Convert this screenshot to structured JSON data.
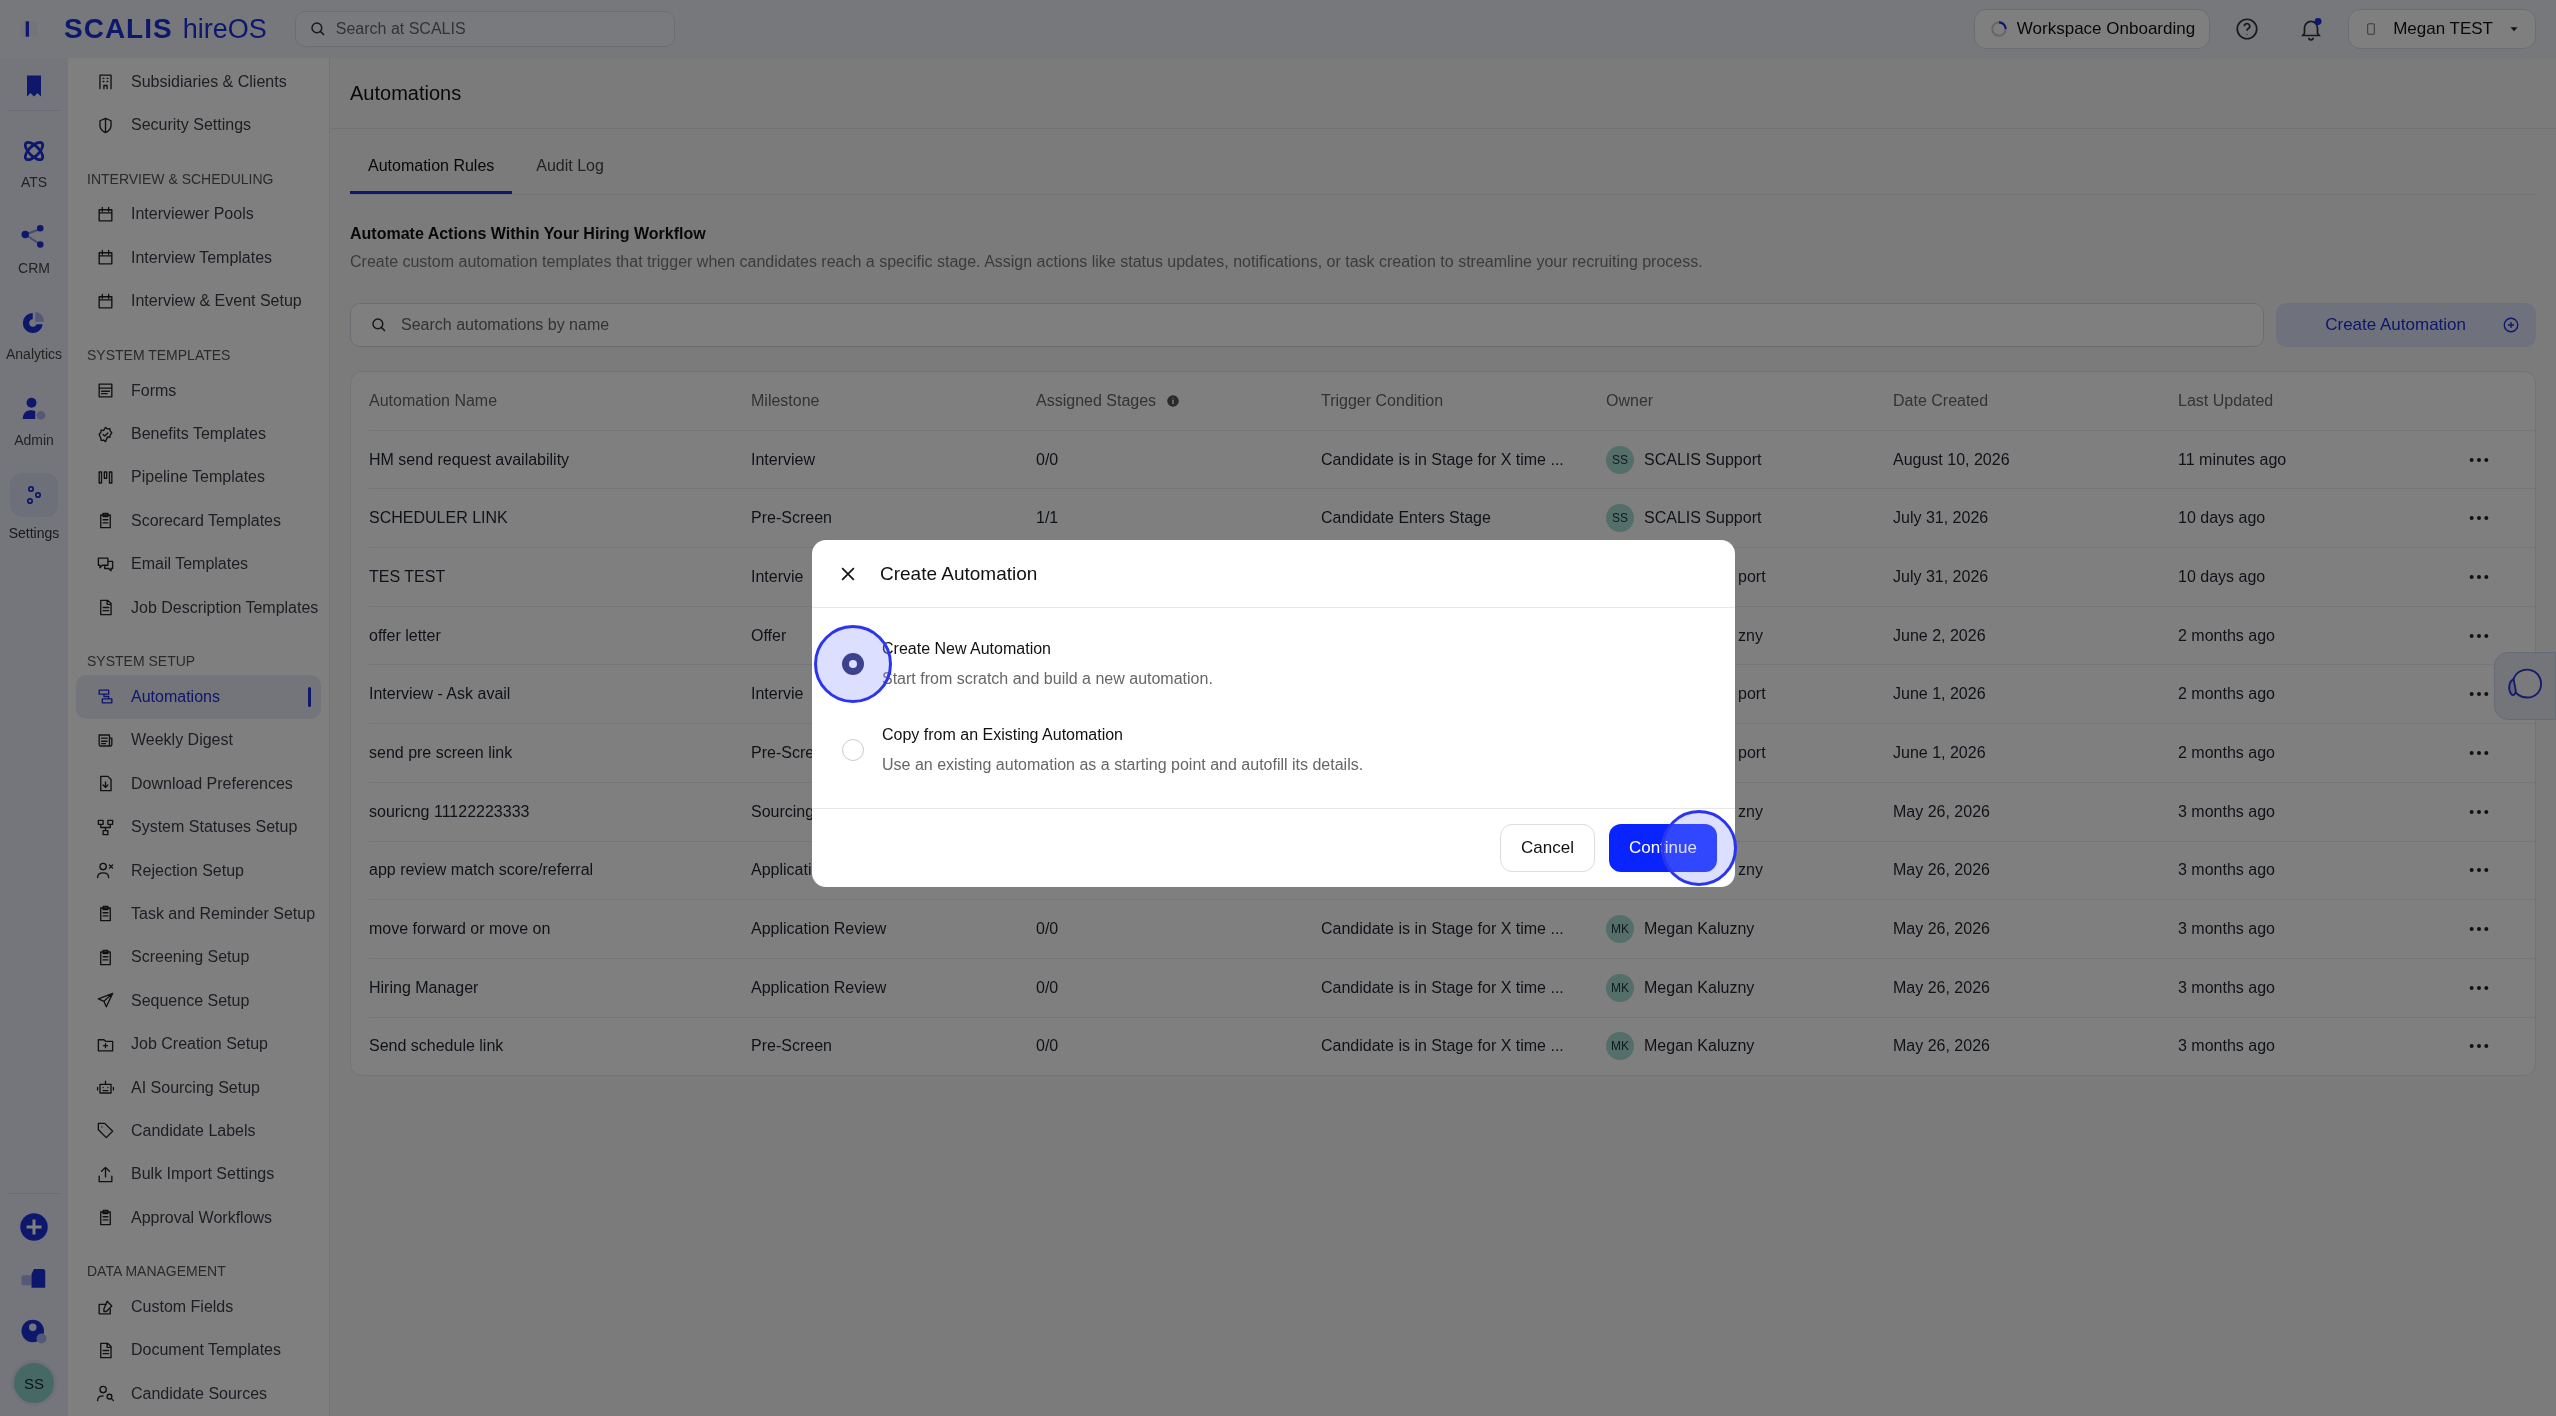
{
  "topbar": {
    "logo": "SCALIS",
    "product": "hireOS",
    "search": {
      "placeholder": "Search at SCALIS"
    },
    "workspace": "Workspace Onboarding",
    "notifications_unread": true,
    "user": "Megan TEST"
  },
  "rail": {
    "items": [
      {
        "label": "ATS",
        "selected": false
      },
      {
        "label": "CRM",
        "selected": false
      },
      {
        "label": "Analytics",
        "selected": false
      },
      {
        "label": "Admin",
        "selected": false
      },
      {
        "label": "Settings",
        "selected": true
      }
    ],
    "avatar": "SS"
  },
  "sidebar": {
    "sections": [
      {
        "items": [
          {
            "label": "Subsidiaries & Clients",
            "selected": false
          },
          {
            "label": "Security Settings",
            "selected": false
          }
        ]
      },
      {
        "title": "INTERVIEW & SCHEDULING",
        "items": [
          {
            "label": "Interviewer Pools",
            "selected": false
          },
          {
            "label": "Interview Templates",
            "selected": false
          },
          {
            "label": "Interview & Event Setup",
            "selected": false
          }
        ]
      },
      {
        "title": "SYSTEM TEMPLATES",
        "items": [
          {
            "label": "Forms",
            "selected": false
          },
          {
            "label": "Benefits Templates",
            "selected": false
          },
          {
            "label": "Pipeline Templates",
            "selected": false
          },
          {
            "label": "Scorecard Templates",
            "selected": false
          },
          {
            "label": "Email Templates",
            "selected": false
          },
          {
            "label": "Job Description Templates",
            "selected": false
          }
        ]
      },
      {
        "title": "SYSTEM SETUP",
        "items": [
          {
            "label": "Automations",
            "selected": true
          },
          {
            "label": "Weekly Digest",
            "selected": false
          },
          {
            "label": "Download Preferences",
            "selected": false
          },
          {
            "label": "System Statuses Setup",
            "selected": false
          },
          {
            "label": "Rejection Setup",
            "selected": false
          },
          {
            "label": "Task and Reminder Setup",
            "selected": false
          },
          {
            "label": "Screening Setup",
            "selected": false
          },
          {
            "label": "Sequence Setup",
            "selected": false
          },
          {
            "label": "Job Creation Setup",
            "selected": false
          },
          {
            "label": "AI Sourcing Setup",
            "selected": false
          },
          {
            "label": "Candidate Labels",
            "selected": false
          },
          {
            "label": "Bulk Import Settings",
            "selected": false
          },
          {
            "label": "Approval Workflows",
            "selected": false
          }
        ]
      },
      {
        "title": "DATA MANAGEMENT",
        "items": [
          {
            "label": "Custom Fields",
            "selected": false
          },
          {
            "label": "Document Templates",
            "selected": false
          },
          {
            "label": "Candidate Sources",
            "selected": false
          }
        ]
      }
    ]
  },
  "page": {
    "title": "Automations",
    "tabs": [
      {
        "label": "Automation Rules",
        "selected": true
      },
      {
        "label": "Audit Log",
        "selected": false
      }
    ],
    "heading": "Automate Actions Within Your Hiring Workflow",
    "description": "Create custom automation templates that trigger when candidates reach a specific stage. Assign actions like status updates, notifications, or task creation to streamline your recruiting process.",
    "search": {
      "placeholder": "Search automations by name"
    },
    "create_button": "Create Automation"
  },
  "table": {
    "columns": [
      {
        "label": "Automation Name",
        "info": false
      },
      {
        "label": "Milestone",
        "info": false
      },
      {
        "label": "Assigned Stages",
        "info": true
      },
      {
        "label": "Trigger Condition",
        "info": false
      },
      {
        "label": "Owner",
        "info": false
      },
      {
        "label": "Date Created",
        "info": false
      },
      {
        "label": "Last Updated",
        "info": false
      }
    ],
    "rows": [
      {
        "name": "HM send request availability",
        "milestone": "Interview",
        "assigned_stages": "0/0",
        "trigger": "Candidate is in Stage for X time ...",
        "owner": {
          "initials": "SS",
          "name": "SCALIS Support"
        },
        "date_created": "August 10, 2026",
        "last_updated": "11 minutes ago"
      },
      {
        "name": "SCHEDULER LINK",
        "milestone": "Pre-Screen",
        "assigned_stages": "1/1",
        "trigger": "Candidate Enters Stage",
        "owner": {
          "initials": "SS",
          "name": "SCALIS Support"
        },
        "date_created": "July 31, 2026",
        "last_updated": "10 days ago"
      },
      {
        "name": "TES TEST",
        "milestone": "Intervie",
        "owner": {
          "name": "port"
        },
        "date_created": "July 31, 2026",
        "last_updated": "10 days ago"
      },
      {
        "name": "offer letter",
        "milestone": "Offer",
        "owner": {
          "name": "zny"
        },
        "date_created": "June 2, 2026",
        "last_updated": "2 months ago"
      },
      {
        "name": "Interview - Ask avail",
        "milestone": "Intervie",
        "owner": {
          "name": "port"
        },
        "date_created": "June 1, 2026",
        "last_updated": "2 months ago"
      },
      {
        "name": "send pre screen link",
        "milestone": "Pre-Scre",
        "owner": {
          "name": "port"
        },
        "date_created": "June 1, 2026",
        "last_updated": "2 months ago"
      },
      {
        "name": "souricng 11122223333",
        "milestone": "Sourcing",
        "owner": {
          "name": "zny"
        },
        "date_created": "May 26, 2026",
        "last_updated": "3 months ago"
      },
      {
        "name": "app review match score/referral",
        "milestone": "Applicati",
        "owner": {
          "name": "zny"
        },
        "date_created": "May 26, 2026",
        "last_updated": "3 months ago"
      },
      {
        "name": "move forward or move on",
        "milestone": "Application Review",
        "assigned_stages": "0/0",
        "trigger": "Candidate is in Stage for X time ...",
        "owner": {
          "initials": "MK",
          "name": "Megan Kaluzny"
        },
        "date_created": "May 26, 2026",
        "last_updated": "3 months ago"
      },
      {
        "name": "Hiring Manager",
        "milestone": "Application Review",
        "assigned_stages": "0/0",
        "trigger": "Candidate is in Stage for X time ...",
        "owner": {
          "initials": "MK",
          "name": "Megan Kaluzny"
        },
        "date_created": "May 26, 2026",
        "last_updated": "3 months ago"
      },
      {
        "name": "Send schedule link",
        "milestone": "Pre-Screen",
        "assigned_stages": "0/0",
        "trigger": "Candidate is in Stage for X time ...",
        "owner": {
          "initials": "MK",
          "name": "Megan Kaluzny"
        },
        "date_created": "May 26, 2026",
        "last_updated": "3 months ago"
      }
    ]
  },
  "dialog": {
    "title": "Create Automation",
    "options": [
      {
        "label": "Create New Automation",
        "description": "Start from scratch and build a new automation.",
        "selected": true,
        "highlighted": true
      },
      {
        "label": "Copy from an Existing Automation",
        "description": "Use an existing automation as a starting point and autofill its details.",
        "selected": false,
        "highlighted": false
      }
    ],
    "buttons": [
      {
        "kind": "secondary",
        "label": "Cancel",
        "highlighted": false
      },
      {
        "kind": "primary",
        "label": "Continue",
        "highlighted": true
      }
    ]
  }
}
